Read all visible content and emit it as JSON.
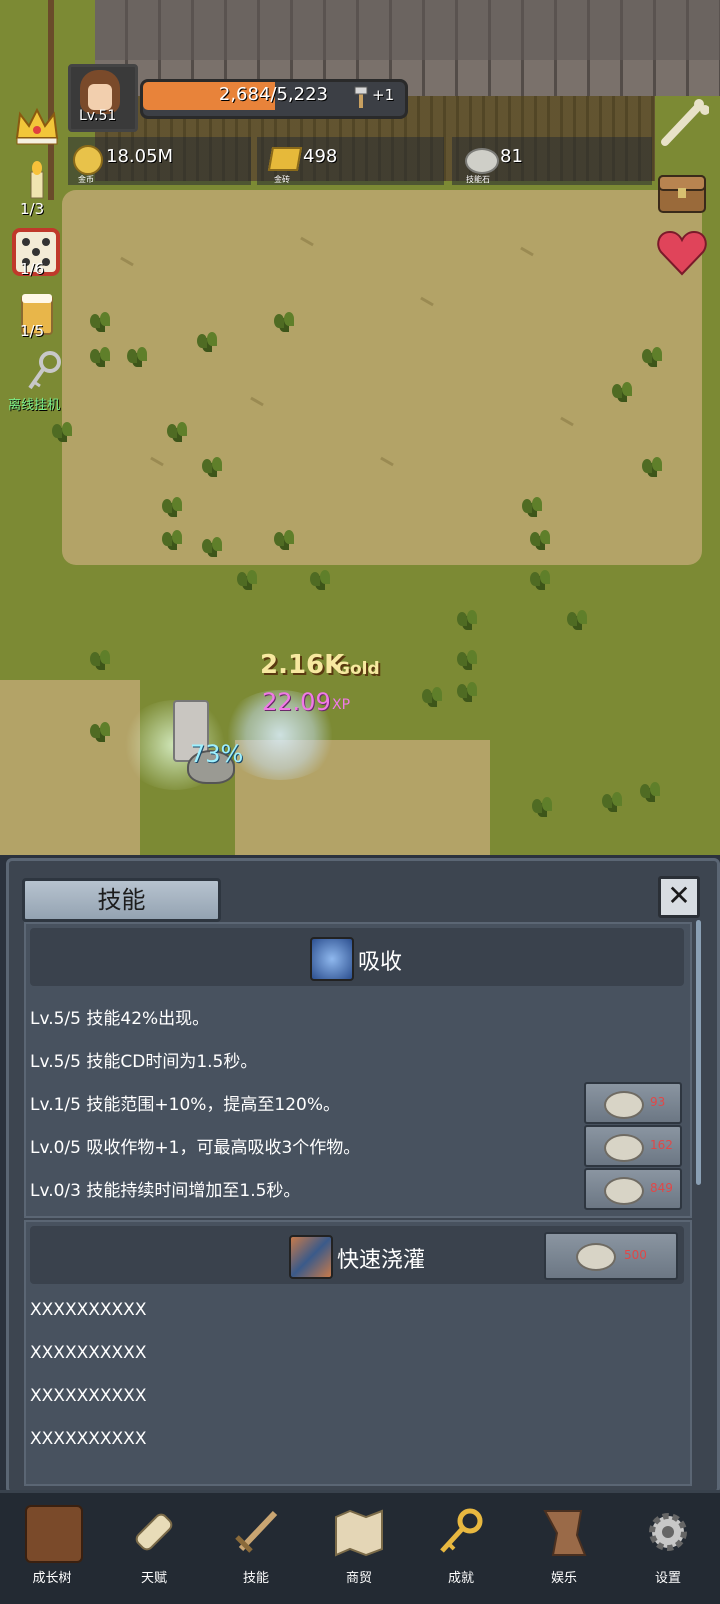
{
  "hud": {
    "level": "Lv.51",
    "xp_text": "2,684/5,223",
    "xp_progress": 0.514,
    "xp_bonus": "+1",
    "gold_value": "18.05M",
    "gold_label": "金币",
    "bar_value": "498",
    "bar_label": "金砖",
    "stone_value": "81",
    "stone_label": "技能石"
  },
  "left_column": {
    "crown_icon": "crown-icon",
    "candle_count": "1/3",
    "dice_count": "1/6",
    "beer_count": "1/5",
    "auto_label": "离线挂机"
  },
  "field": {
    "gold_amount": "2.16K",
    "gold_unit": "Gold",
    "xp_amount": "22.09",
    "xp_unit": "XP",
    "skill_percent": "73%"
  },
  "panel": {
    "title": "技能",
    "close_symbol": "✕",
    "skill1": {
      "name": "吸收",
      "lines": [
        {
          "text": "Lv.5/5 技能42%出现。",
          "cost": ""
        },
        {
          "text": "Lv.5/5 技能CD时间为1.5秒。",
          "cost": ""
        },
        {
          "text": "Lv.1/5 技能范围+10%，提高至120%。",
          "cost": "93"
        },
        {
          "text": "Lv.0/5 吸收作物+1，可最高吸收3个作物。",
          "cost": "162"
        },
        {
          "text": "Lv.0/3 技能持续时间增加至1.5秒。",
          "cost": "849"
        }
      ]
    },
    "skill2": {
      "name": "快速浇灌",
      "unlock_cost": "500",
      "lines": [
        "XXXXXXXXXX",
        "XXXXXXXXXX",
        "XXXXXXXXXX",
        "XXXXXXXXXX"
      ]
    }
  },
  "nav": [
    {
      "label": "成长树",
      "icon": "book-icon"
    },
    {
      "label": "天赋",
      "icon": "scroll-icon"
    },
    {
      "label": "技能",
      "icon": "sword-icon"
    },
    {
      "label": "商贸",
      "icon": "map-icon"
    },
    {
      "label": "成就",
      "icon": "key-icon"
    },
    {
      "label": "娱乐",
      "icon": "banner-icon"
    },
    {
      "label": "设置",
      "icon": "gear-icon"
    }
  ],
  "colors": {
    "xp_fill": "#e8833a",
    "panel_bg": "#3d4550",
    "cost_red": "#e04848",
    "xp_text": "#f07ae6",
    "gold_text": "#f7e9a0"
  }
}
